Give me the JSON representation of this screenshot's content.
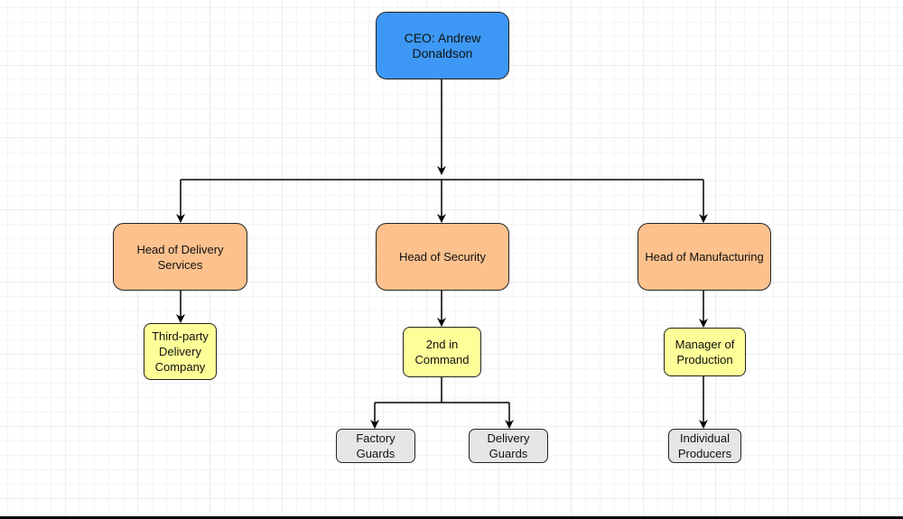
{
  "colors": {
    "ceo": "#3d98f5",
    "head": "#fdc18d",
    "manager": "#ffff99",
    "staff": "#e6e6e6"
  },
  "nodes": {
    "ceo": "CEO: Andrew Donaldson",
    "head_delivery": "Head of Delivery Services",
    "head_security": "Head of Security",
    "head_manufacturing": "Head of Manufacturing",
    "third_party": "Third-party\nDelivery\nCompany",
    "second_in_command": "2nd in\nCommand",
    "manager_production": "Manager of\nProduction",
    "factory_guards": "Factory\nGuards",
    "delivery_guards": "Delivery\nGuards",
    "individual_producers": "Individual\nProducers"
  }
}
